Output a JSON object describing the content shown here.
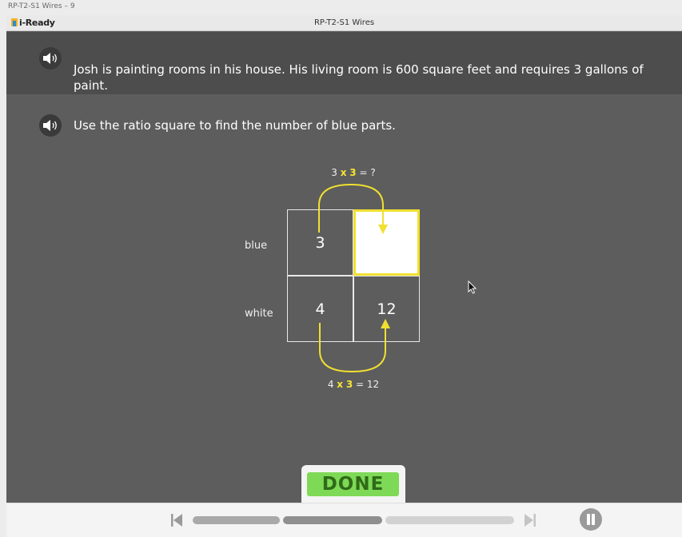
{
  "window": {
    "outer_title": "RP-T2-S1 Wires – 9"
  },
  "topbar": {
    "logo": "i-Ready",
    "title": "RP-T2-S1 Wires"
  },
  "prompt": {
    "text": "Josh is painting rooms in his house. His living room is 600 square feet and requires 3 gallons of paint."
  },
  "instruction": {
    "text": "Use the ratio square to find the number of blue parts."
  },
  "ratio_square": {
    "row_labels": [
      "blue",
      "white"
    ],
    "cells": {
      "blue_1": "3",
      "blue_2": "",
      "white_1": "4",
      "white_2": "12"
    },
    "eq_top": {
      "a": "3",
      "op": "x",
      "m": "3",
      "rest": "= ?"
    },
    "eq_bottom": {
      "a": "4",
      "op": "x",
      "m": "3",
      "rest": "= 12"
    },
    "highlight_color": "#f0e030"
  },
  "actions": {
    "done_label": "DONE"
  },
  "player": {
    "progress_segments": 3,
    "current_segment": 2
  },
  "icons": {
    "speaker": "speaker-icon",
    "prev": "skip-back-icon",
    "next": "skip-forward-icon",
    "pause": "pause-icon",
    "cursor": "mouse-cursor-icon"
  }
}
